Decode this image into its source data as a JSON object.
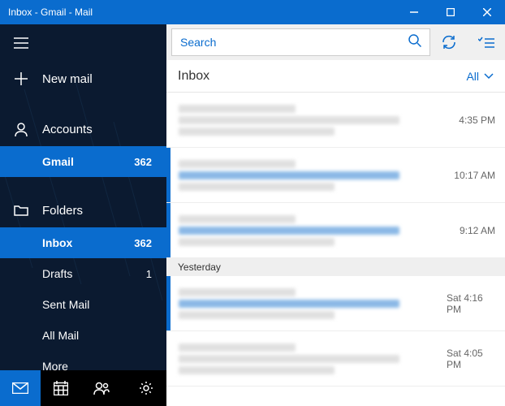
{
  "window": {
    "title": "Inbox - Gmail - Mail"
  },
  "sidebar": {
    "new_mail": "New mail",
    "accounts": "Accounts",
    "account_item": {
      "label": "Gmail",
      "count": "362"
    },
    "folders": "Folders",
    "folder_items": [
      {
        "label": "Inbox",
        "count": "362",
        "selected": true,
        "bold": true
      },
      {
        "label": "Drafts",
        "count": "1",
        "selected": false,
        "bold": false
      },
      {
        "label": "Sent Mail",
        "count": "",
        "selected": false,
        "bold": false
      },
      {
        "label": "All Mail",
        "count": "",
        "selected": false,
        "bold": false
      },
      {
        "label": "More",
        "count": "",
        "selected": false,
        "bold": false
      }
    ]
  },
  "search": {
    "placeholder": "Search"
  },
  "list": {
    "title": "Inbox",
    "filter": "All"
  },
  "groups": {
    "yesterday": "Yesterday"
  },
  "messages": [
    {
      "time": "4:35 PM",
      "unread": false
    },
    {
      "time": "10:17 AM",
      "unread": true
    },
    {
      "time": "9:12 AM",
      "unread": true
    },
    {
      "time": "Sat 4:16 PM",
      "unread": true
    },
    {
      "time": "Sat 4:05 PM",
      "unread": false
    }
  ]
}
